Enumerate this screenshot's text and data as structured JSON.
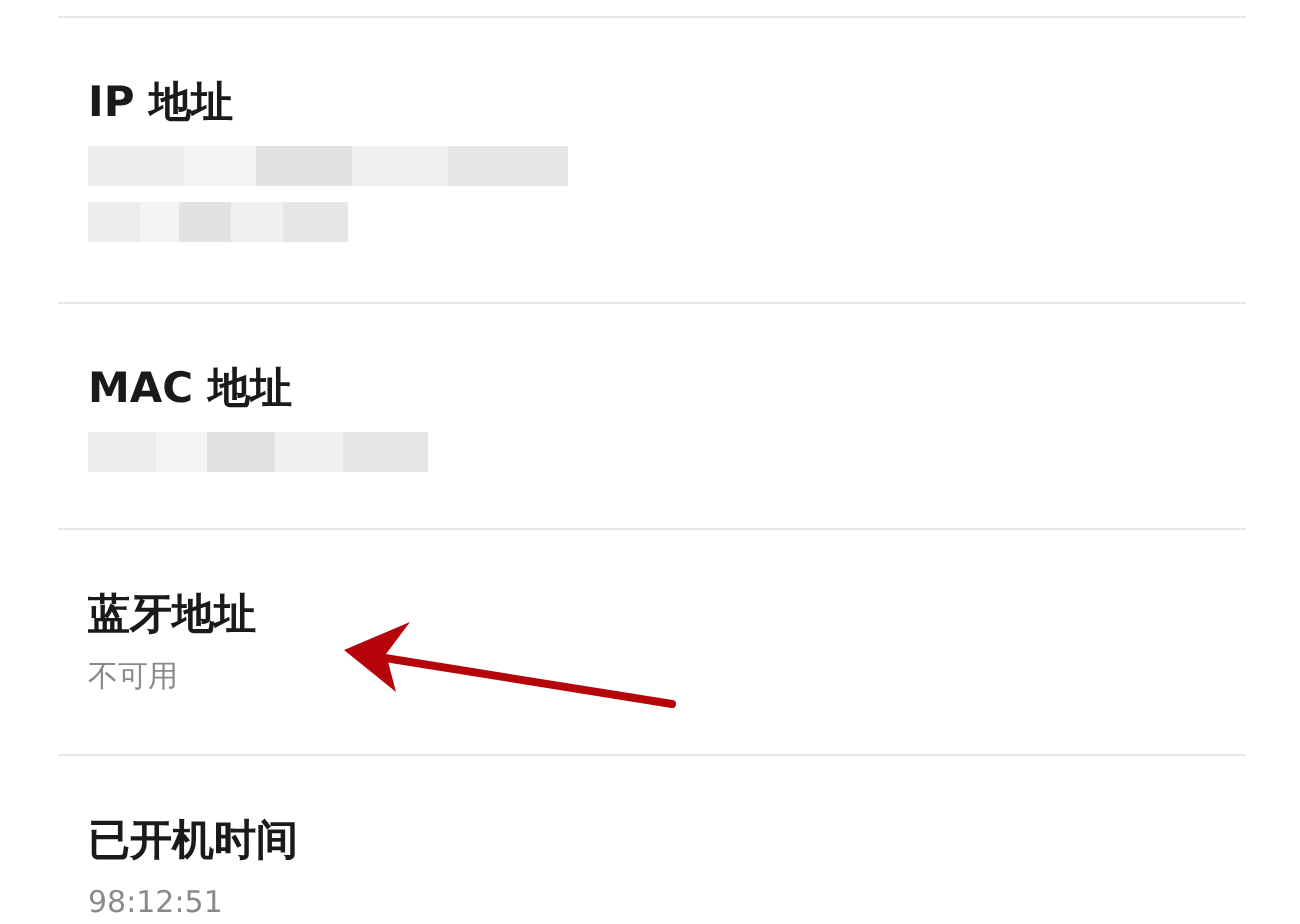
{
  "rows": [
    {
      "title": "IP 地址",
      "values": [
        {
          "kind": "redacted"
        },
        {
          "kind": "redacted"
        }
      ]
    },
    {
      "title": "MAC 地址",
      "values": [
        {
          "kind": "redacted"
        }
      ]
    },
    {
      "title": "蓝牙地址",
      "values": [
        {
          "kind": "text",
          "text": "不可用"
        }
      ]
    },
    {
      "title": "已开机时间",
      "values": [
        {
          "kind": "text",
          "text": "98:12:51"
        }
      ]
    }
  ]
}
